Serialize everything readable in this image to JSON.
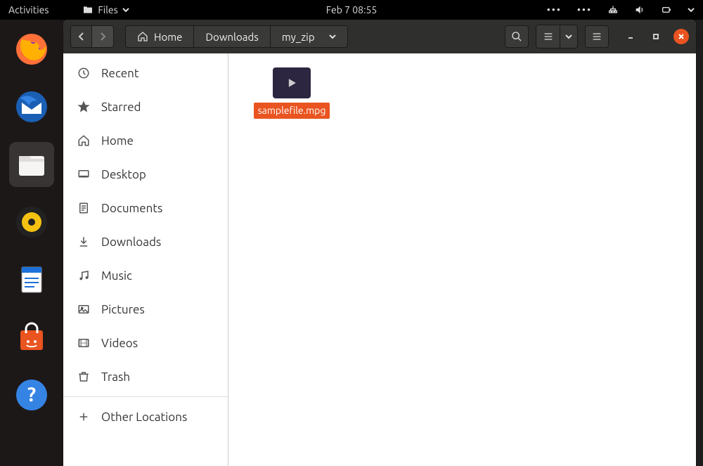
{
  "topbar": {
    "activities": "Activities",
    "app_menu": "Files",
    "clock": "Feb 7  08:55"
  },
  "pathbar": {
    "home": "Home",
    "seg1": "Downloads",
    "seg2": "my_zip"
  },
  "sidebar": {
    "recent": "Recent",
    "starred": "Starred",
    "home": "Home",
    "desktop": "Desktop",
    "documents": "Documents",
    "downloads": "Downloads",
    "music": "Music",
    "pictures": "Pictures",
    "videos": "Videos",
    "trash": "Trash",
    "other": "Other Locations"
  },
  "files": [
    {
      "name": "samplefile.mpg",
      "type": "video",
      "selected": true
    }
  ]
}
